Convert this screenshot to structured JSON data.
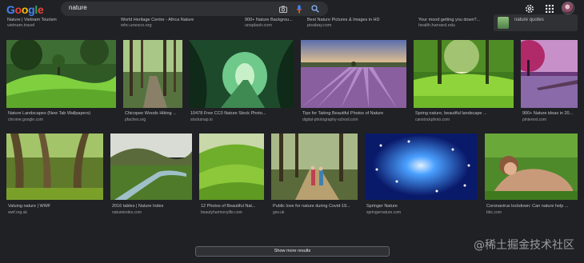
{
  "colors": {
    "background": "#202124",
    "search_bg": "#303134",
    "text": "#bdc1c6",
    "muted": "#9aa0a6",
    "accent_blue": "#8ab4f8"
  },
  "header": {
    "logo": [
      "G",
      "o",
      "o",
      "g",
      "l",
      "e"
    ],
    "search_value": "nature",
    "icons": [
      "camera-icon",
      "mic-icon",
      "search-icon",
      "gear-icon",
      "apps-grid-icon",
      "avatar"
    ]
  },
  "partial_row": [
    {
      "title": "Nature | Vietnam Tourism",
      "source": "vietnam.travel"
    },
    {
      "title": "World Heritage Centre - Africa Nature",
      "source": "whc.unesco.org"
    },
    {
      "title": "900+ Nature Backgrou...",
      "source": "unsplash.com"
    },
    {
      "title": "Best Nature Pictures & Images in HD",
      "source": "pixabay.com"
    },
    {
      "title": "Your mood getting you down?...",
      "source": "health.harvard.edu"
    }
  ],
  "quotes_card": {
    "label": "nature quotes"
  },
  "row1": [
    {
      "caption": "Nature Landscapes (New Tab Wallpapers)",
      "source": "chrome.google.com"
    },
    {
      "caption": "Chicopee Woods Hiking ...",
      "source": "pfaches.org"
    },
    {
      "caption": "10478 Free CC0 Nature Stock Photo...",
      "source": "stocksnap.io"
    },
    {
      "caption": "Tips for Taking Beautiful Photos of Nature",
      "source": "digital-photography-school.com"
    },
    {
      "caption": "Spring nature, beautiful landscape ...",
      "source": "canstockphoto.com"
    },
    {
      "caption": "900+ Nature ideas in 20...",
      "source": "pinterest.com"
    }
  ],
  "row2": [
    {
      "caption": "Valuing nature | WWF",
      "source": "wwf.org.uk"
    },
    {
      "caption": "2016 tables | Nature Index",
      "source": "natureindex.com"
    },
    {
      "caption": "12 Photos of Beautiful Nat...",
      "source": "beautyharmonylife.com"
    },
    {
      "caption": "Public love for nature during Covid-19...",
      "source": "gov.uk"
    },
    {
      "caption": "Springer Nature",
      "source": "springernature.com"
    },
    {
      "caption": "Coronavirus lockdown: Can nature help ...",
      "source": "bbc.com"
    }
  ],
  "show_more": "Show more results",
  "watermark": "@稀土掘金技术社区"
}
